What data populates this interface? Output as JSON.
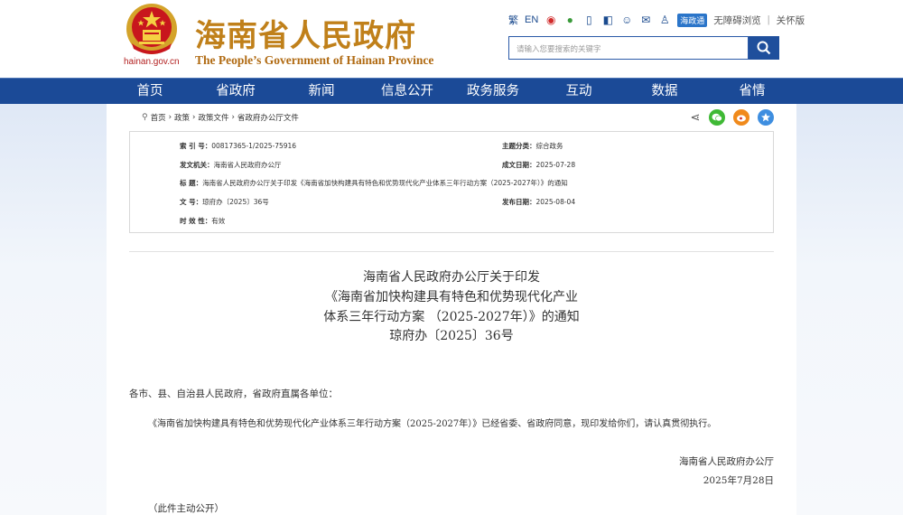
{
  "header": {
    "emblem_url": "hainan.gov.cn",
    "logo_cn": "海南省人民政府",
    "logo_en": "The People’s Government  of Hainan Province",
    "lang_trad": "繁",
    "lang_en": "EN",
    "hzt": "海政通",
    "accessibility": "无障碍浏览",
    "senior": "关怀版",
    "search_placeholder": "请输入您要搜索的关键字"
  },
  "nav": [
    "首页",
    "省政府",
    "新闻",
    "信息公开",
    "政务服务",
    "互动",
    "数据",
    "省情"
  ],
  "breadcrumb": [
    "首页",
    "政策",
    "政策文件",
    "省政府办公厅文件"
  ],
  "meta": {
    "index_label": "索 引 号：",
    "index_value": "00817365-1/2025-75916",
    "topic_label": "主题分类：",
    "topic_value": "综合政务",
    "issuer_label": "发文机关：",
    "issuer_value": "海南省人民政府办公厅",
    "date_label": "成文日期：",
    "date_value": "2025-07-28",
    "title_label": "标    题：",
    "title_value": "海南省人民政府办公厅关于印发《海南省加快构建具有特色和优势现代化产业体系三年行动方案（2025-2027年）》的通知",
    "docno_label": "文    号：",
    "docno_value": "琼府办〔2025〕36号",
    "pub_label": "发布日期：",
    "pub_value": "2025-08-04",
    "valid_label": "时 效 性：",
    "valid_value": "有效"
  },
  "article": {
    "title_lines": [
      "海南省人民政府办公厅关于印发",
      "《海南省加快构建具有特色和优势现代化产业",
      "体系三年行动方案 （2025-2027年）》的通知",
      "琼府办〔2025〕36号"
    ],
    "salutation": "各市、县、自治县人民政府，省政府直属各单位：",
    "paragraph": "《海南省加快构建具有特色和优势现代化产业体系三年行动方案（2025-2027年）》已经省委、省政府同意，现印发给你们，请认真贯彻执行。",
    "signature": "海南省人民政府办公厅",
    "sign_date": "2025年7月28日",
    "note": "（此件主动公开）"
  },
  "colors": {
    "nav_bg": "#1b4a97",
    "logo_gold": "#c0801a",
    "emblem_red": "#c8161d"
  }
}
